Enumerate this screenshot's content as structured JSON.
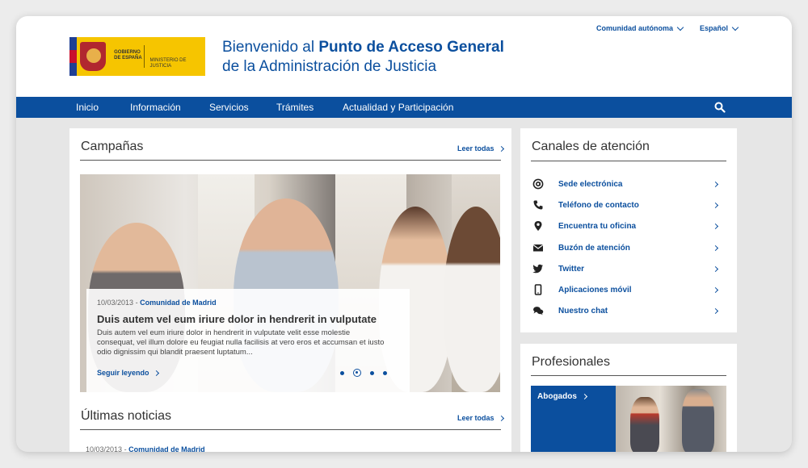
{
  "header": {
    "logo_left": "GOBIERNO DE ESPAÑA",
    "logo_right": "MINISTERIO DE JUSTICIA",
    "title_prefix": "Bienvenido al ",
    "title_bold": "Punto de Acceso General",
    "title_line2": "de la Administración de Justicia",
    "region_select": "Comunidad autónoma",
    "language_select": "Español"
  },
  "nav": {
    "items": [
      "Inicio",
      "Información",
      "Servicios",
      "Trámites",
      "Actualidad y Participación"
    ]
  },
  "campaigns": {
    "title": "Campañas",
    "read_all": "Leer todas",
    "slide": {
      "date": "10/03/2013",
      "separator": "-",
      "region": "Comunidad de Madrid",
      "headline": "Duis autem vel eum iriure dolor in hendrerit in vulputate",
      "body": "Duis autem vel eum iriure dolor in hendrerit in vulputate velit esse molestie consequat, vel illum dolore eu feugiat nulla facilisis at vero eros et accumsan et iusto odio dignissim qui blandit praesent luptatum...",
      "more": "Seguir leyendo"
    },
    "active_slide": 2,
    "slide_count": 4
  },
  "news": {
    "title": "Últimas noticias",
    "read_all": "Leer todas",
    "first_date": "10/03/2013",
    "first_separator": "-",
    "first_region": "Comunidad de Madrid"
  },
  "channels": {
    "title": "Canales de atención",
    "items": [
      {
        "icon": "at-icon",
        "label": "Sede electrónica"
      },
      {
        "icon": "phone-icon",
        "label": "Teléfono de contacto"
      },
      {
        "icon": "map-pin-icon",
        "label": "Encuentra tu oficina"
      },
      {
        "icon": "envelope-icon",
        "label": "Buzón de atención"
      },
      {
        "icon": "twitter-icon",
        "label": "Twitter"
      },
      {
        "icon": "mobile-icon",
        "label": "Aplicaciones móvil"
      },
      {
        "icon": "chat-icon",
        "label": "Nuestro chat"
      }
    ]
  },
  "professionals": {
    "title": "Profesionales",
    "card": "Abogados"
  },
  "colors": {
    "brand_blue": "#0b4f9e",
    "logo_yellow": "#f6c500",
    "background": "#e6e6e6"
  }
}
